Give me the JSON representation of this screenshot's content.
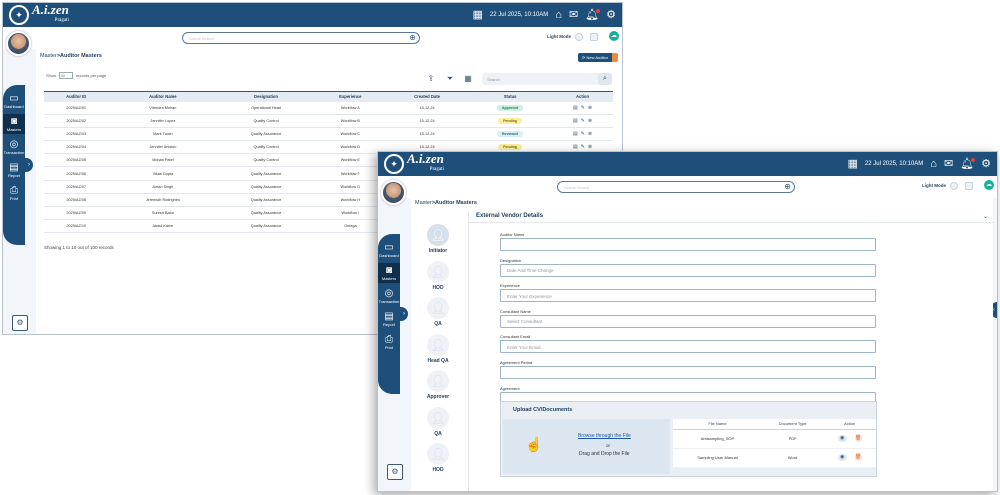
{
  "app": {
    "logo_main": "A.i.zen",
    "logo_sub": "Pragati",
    "datetime": "22 Jul 2025, 10:10AM",
    "search_placeholder": "Global Search",
    "light_mode_label": "Light Mode",
    "icons": {
      "calendar": "calendar-icon",
      "home": "home-icon",
      "chat": "chat-icon",
      "bell": "bell-icon",
      "settings": "gear-icon"
    }
  },
  "sidebar": {
    "items": [
      {
        "label": "Dashboard",
        "icon": "dashboard-icon"
      },
      {
        "label": "Masters",
        "icon": "masters-icon"
      },
      {
        "label": "Transaction",
        "icon": "transaction-icon"
      },
      {
        "label": "Report",
        "icon": "report-icon"
      },
      {
        "label": "Print",
        "icon": "print-icon"
      }
    ]
  },
  "list": {
    "breadcrumb_root": "Master",
    "breadcrumb_current": ">Auditor Masters",
    "new_button": "New Auditor",
    "show_label": "Show",
    "page_size": "10",
    "records_label": "records per page",
    "search_placeholder": "Search",
    "columns": [
      "Auditor ID",
      "Auditor Name",
      "Designation",
      "Experience",
      "Created Date",
      "Status",
      "Action"
    ],
    "rows": [
      {
        "id": "2025/AZ/01",
        "name": "Virendra Mohan",
        "designation": "Operational Head",
        "experience": "Workflow A",
        "date": "15-12-24",
        "status": "Approved",
        "status_class": "approved"
      },
      {
        "id": "2025/AZ/02",
        "name": "Jennifer Lopez",
        "designation": "Quality Control",
        "experience": "Workflow B",
        "date": "15-12-24",
        "status": "Pending",
        "status_class": "pending"
      },
      {
        "id": "2025/AZ/03",
        "name": "Mark Twain",
        "designation": "Quality Assurance",
        "experience": "Workflow C",
        "date": "15-12-24",
        "status": "Reviewed",
        "status_class": "reviewed"
      },
      {
        "id": "2025/AZ/04",
        "name": "Jennifer Aniston",
        "designation": "Quality Control",
        "experience": "Workflow D",
        "date": "15-12-24",
        "status": "Pending",
        "status_class": "pending"
      },
      {
        "id": "2025/AZ/05",
        "name": "Mohan Patel",
        "designation": "Quality Control",
        "experience": "Workflow E",
        "date": "",
        "status": "",
        "status_class": ""
      },
      {
        "id": "2025/AZ/06",
        "name": "Vikas Gupta",
        "designation": "Quality Assurance",
        "experience": "Workflow F",
        "date": "",
        "status": "",
        "status_class": ""
      },
      {
        "id": "2025/AZ/07",
        "name": "Aman Singh",
        "designation": "Quality Assurance",
        "experience": "Workflow G",
        "date": "",
        "status": "",
        "status_class": ""
      },
      {
        "id": "2025/AZ/08",
        "name": "Jeremiah Rodrigheo",
        "designation": "Quality Assurance",
        "experience": "Workflow H",
        "date": "",
        "status": "",
        "status_class": ""
      },
      {
        "id": "2025/AZ/09",
        "name": "Suresh Babu",
        "designation": "Quality Assurance",
        "experience": "Workflow I",
        "date": "",
        "status": "",
        "status_class": ""
      },
      {
        "id": "2025/AZ/10",
        "name": "Abdul Karim",
        "designation": "Quality Assurance",
        "experience": "Omega",
        "date": "",
        "status": "",
        "status_class": ""
      }
    ],
    "footer": "Showing 1 to 10 out of 100 records"
  },
  "form": {
    "breadcrumb_root": "Master",
    "breadcrumb_current": ">Auditor Masters",
    "panel_title": "External Vendor Details",
    "steps": [
      "Initiator",
      "HOD",
      "QA",
      "Head QA",
      "Approver",
      "QA",
      "HOD"
    ],
    "fields": [
      {
        "label": "Auditor Name",
        "placeholder": ""
      },
      {
        "label": "Designation",
        "placeholder": "Date And Time Change"
      },
      {
        "label": "Experience",
        "placeholder": "Enter Your Experience"
      },
      {
        "label": "Consultant Name",
        "placeholder": "Select Consultant"
      },
      {
        "label": "Consultant Email",
        "placeholder": "Enter Your Email"
      },
      {
        "label": "Agreement Period",
        "placeholder": ""
      },
      {
        "label": "Agreement",
        "placeholder": ""
      }
    ],
    "upload": {
      "title": "Upload CV/Documents",
      "browse": "Browse through the File",
      "or": "or",
      "drag": "Drag and Drop the File",
      "columns": [
        "File Name",
        "Document Type",
        "Action"
      ],
      "files": [
        {
          "name": "Antisampling_SOP",
          "type": "PDF"
        },
        {
          "name": "Sampling User Manual",
          "type": "Word"
        }
      ]
    }
  }
}
